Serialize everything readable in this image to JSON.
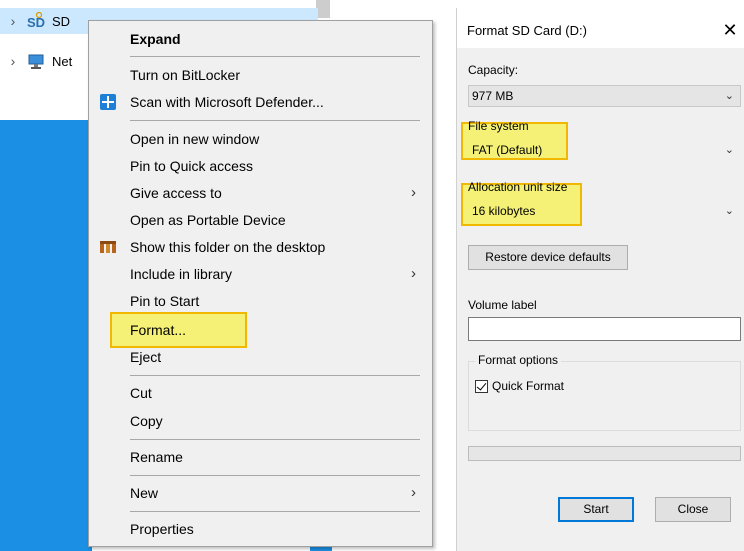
{
  "explorer": {
    "tree": [
      {
        "label": "SD",
        "icon": "sd-card-icon",
        "selected": true
      },
      {
        "label": "Net",
        "icon": "network-icon",
        "selected": false
      }
    ]
  },
  "context_menu": {
    "items": [
      {
        "label": "Expand",
        "bold": true
      },
      {
        "label": "Turn on BitLocker"
      },
      {
        "label": "Scan with Microsoft Defender...",
        "icon": "defender-shield-icon"
      },
      {
        "label": "Open in new window"
      },
      {
        "label": "Pin to Quick access"
      },
      {
        "label": "Give access to",
        "submenu": true
      },
      {
        "label": "Open as Portable Device"
      },
      {
        "label": "Show this folder on the desktop",
        "icon": "app-logo-icon"
      },
      {
        "label": "Include in library",
        "submenu": true
      },
      {
        "label": "Pin to Start"
      },
      {
        "label": "Format...",
        "highlighted": true
      },
      {
        "label": "Eject"
      },
      {
        "label": "Cut"
      },
      {
        "label": "Copy"
      },
      {
        "label": "Rename"
      },
      {
        "label": "New",
        "submenu": true
      },
      {
        "label": "Properties"
      }
    ]
  },
  "format_dialog": {
    "title": "Format SD Card (D:)",
    "close_glyph": "✕",
    "capacity_label": "Capacity:",
    "capacity_value": "977 MB",
    "filesystem_label": "File system",
    "filesystem_value": "FAT (Default)",
    "allocation_label": "Allocation unit size",
    "allocation_value": "16 kilobytes",
    "restore_button": "Restore device defaults",
    "volume_label": "Volume label",
    "volume_value": "",
    "format_options_label": "Format options",
    "quick_format_label": "Quick Format",
    "quick_format_checked": true,
    "progress": 0,
    "start_button": "Start",
    "close_button": "Close"
  },
  "colors": {
    "highlight_fill": "#f4f176",
    "highlight_border": "#f0b800",
    "accent": "#0078d7",
    "desktop_blue": "#1a8fe3"
  }
}
